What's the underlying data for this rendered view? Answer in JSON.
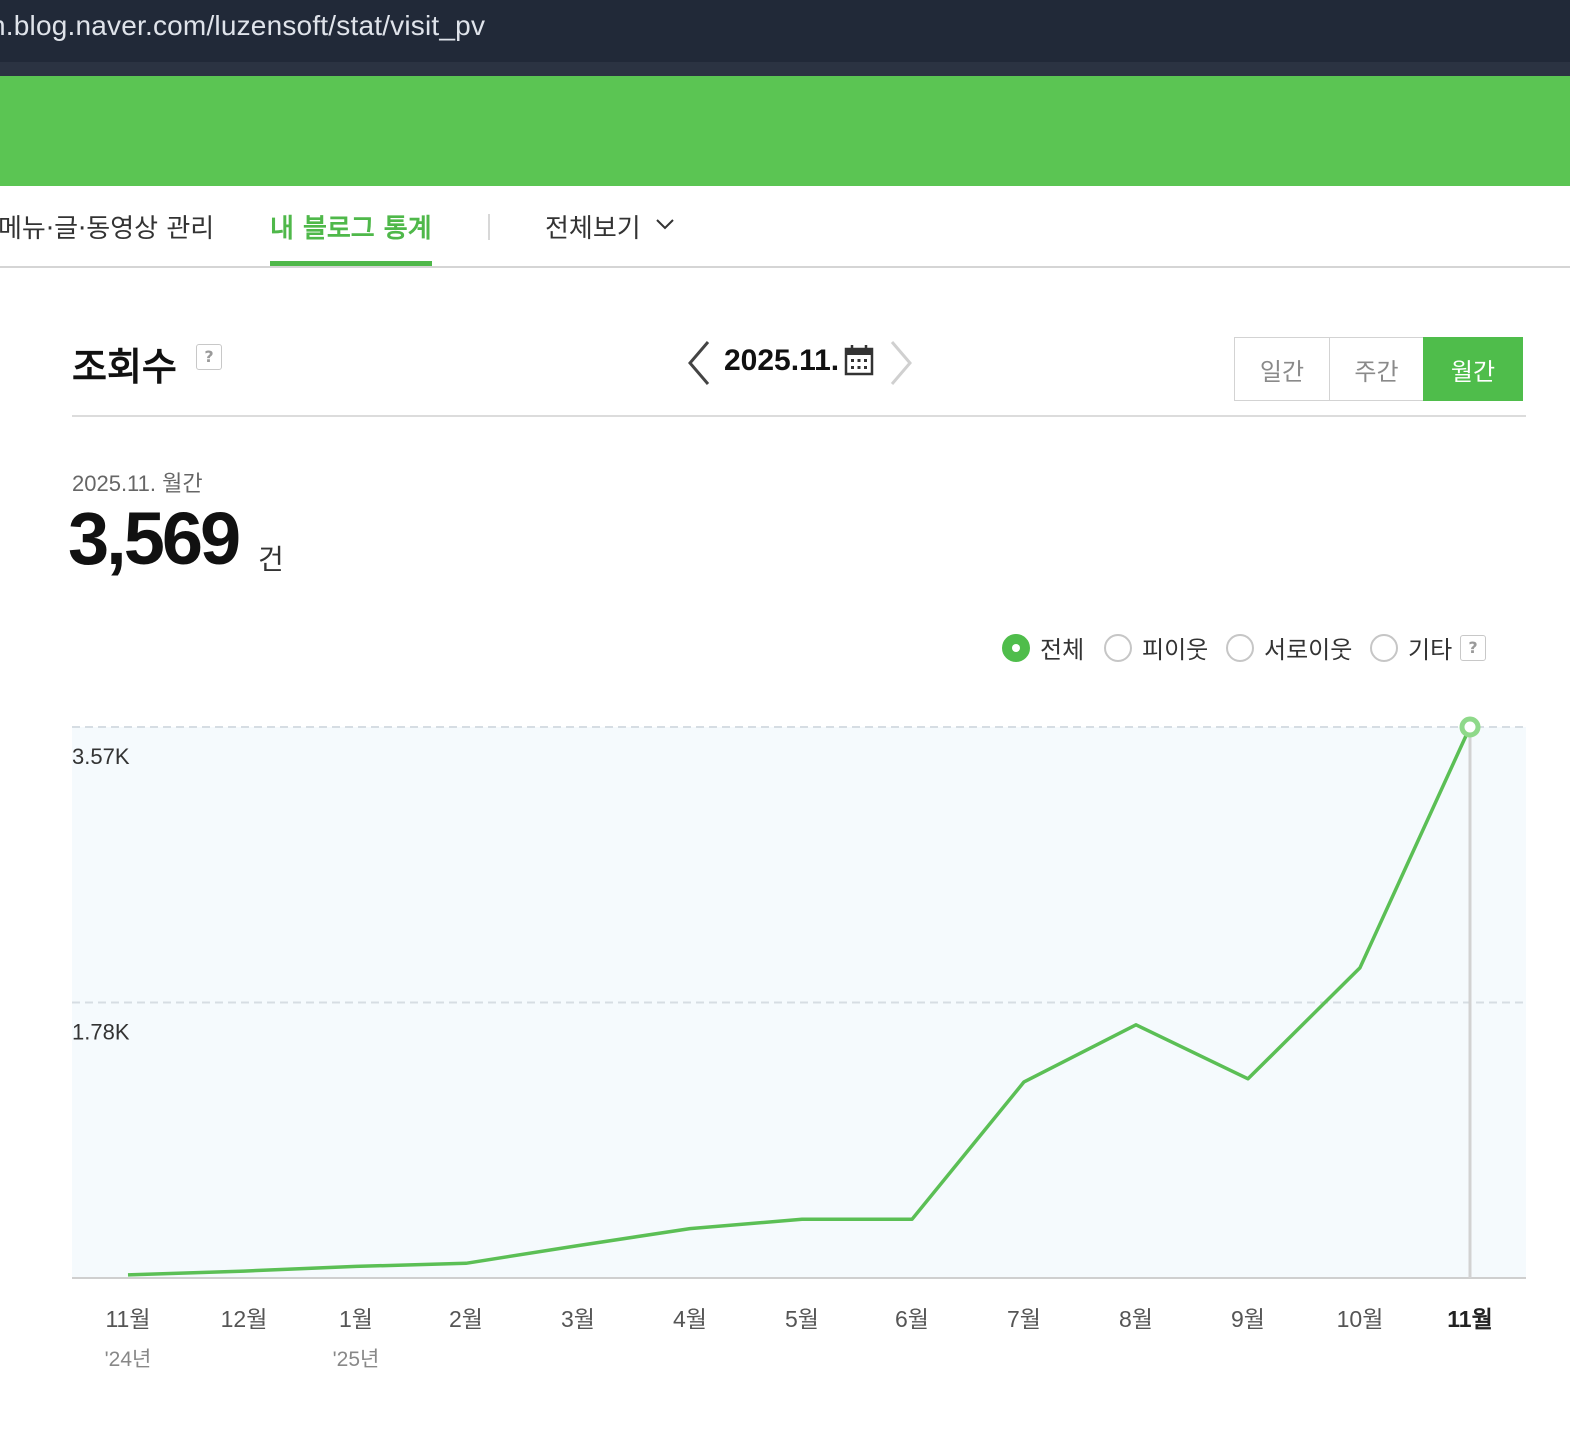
{
  "browser": {
    "url": "n.blog.naver.com/luzensoft/stat/visit_pv"
  },
  "nav": {
    "items": [
      "메뉴·글·동영상 관리",
      "내 블로그 통계",
      "전체보기"
    ],
    "active": "내 블로그 통계"
  },
  "header": {
    "title": "조회수",
    "help": "?",
    "date": "2025.11.",
    "periods": [
      "일간",
      "주간",
      "월간"
    ],
    "active_period": "월간"
  },
  "summary": {
    "label": "2025.11. 월간",
    "value": "3,569",
    "unit": "건"
  },
  "legend": {
    "options": [
      "전체",
      "피이웃",
      "서로이웃",
      "기타"
    ],
    "selected": "전체",
    "help": "?"
  },
  "colors": {
    "accent": "#4fbd4b",
    "topbar": "#5bc553",
    "line": "#5bbf55",
    "plot_bg": "#f5fafd"
  },
  "chart_data": {
    "type": "line",
    "categories": [
      "11월",
      "12월",
      "1월",
      "2월",
      "3월",
      "4월",
      "5월",
      "6월",
      "7월",
      "8월",
      "9월",
      "10월",
      "11월"
    ],
    "year_labels": [
      {
        "index": 0,
        "label": "'24년"
      },
      {
        "index": 2,
        "label": "'25년"
      }
    ],
    "series": [
      {
        "values": [
          20,
          45,
          75,
          95,
          210,
          320,
          380,
          380,
          1270,
          1640,
          1290,
          2010,
          3569
        ]
      }
    ],
    "yticks": [
      {
        "value": 3569,
        "label": "3.57K"
      },
      {
        "value": 1784.5,
        "label": "1.78K"
      }
    ],
    "ylim": [
      0,
      3569
    ],
    "highlight_index": 12,
    "grid": "dashed horizontal"
  }
}
